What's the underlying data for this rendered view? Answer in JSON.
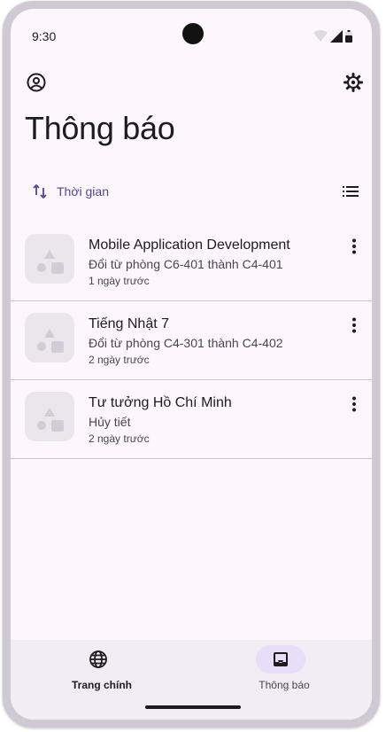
{
  "status_bar": {
    "time": "9:30"
  },
  "header": {
    "account_icon": "account-circle-icon",
    "settings_icon": "gear-icon",
    "title": "Thông báo"
  },
  "sort": {
    "label": "Thời gian",
    "icon": "swap-vert-icon"
  },
  "view_toggle_icon": "list-icon",
  "notifications": [
    {
      "title": "Mobile Application Development",
      "subtitle": "Đổi từ phòng C6-401 thành C4-401",
      "time": "1 ngày trước"
    },
    {
      "title": "Tiếng Nhật 7",
      "subtitle": "Đổi từ phòng C4-301 thành C4-402",
      "time": "2 ngày trước"
    },
    {
      "title": "Tư tưởng Hồ Chí Minh",
      "subtitle": "Hủy tiết",
      "time": "2 ngày trước"
    }
  ],
  "nav": {
    "items": [
      {
        "label": "Trang chính",
        "icon": "globe-icon",
        "active": false
      },
      {
        "label": "Thông báo",
        "icon": "inbox-icon",
        "active": true
      }
    ]
  },
  "colors": {
    "background": "#fdf7fd",
    "accent": "#52478f",
    "nav_background": "#f2ecf4",
    "nav_indicator": "#e8def8",
    "thumbnail": "#ebe5ec"
  }
}
